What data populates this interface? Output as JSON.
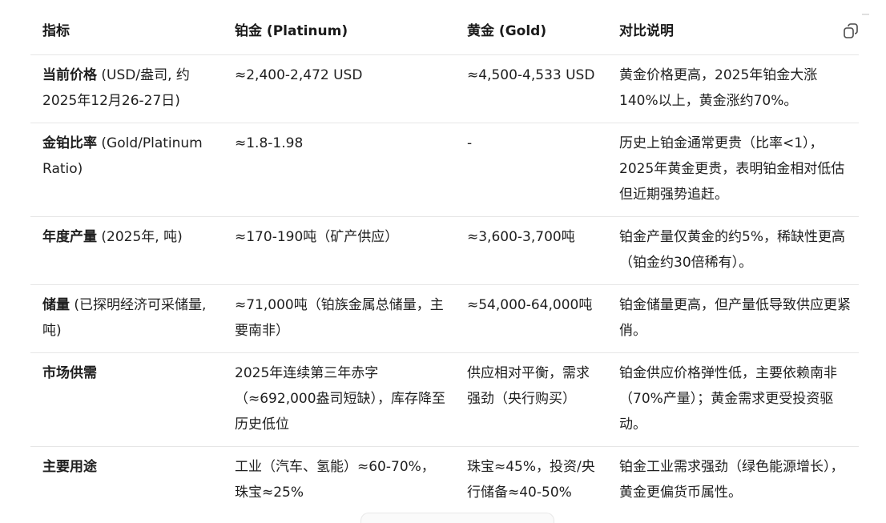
{
  "table": {
    "headers": [
      "指标",
      "铂金 (Platinum)",
      "黄金 (Gold)",
      "对比说明"
    ],
    "rows": [
      {
        "metric_bold": "当前价格",
        "metric_rest": " (USD/盎司, 约2025年12月26-27日)",
        "platinum": "≈2,400-2,472 USD",
        "gold": "≈4,500-4,533 USD",
        "note": "黄金价格更高，2025年铂金大涨140%以上，黄金涨约70%。"
      },
      {
        "metric_bold": "金铂比率",
        "metric_rest": " (Gold/Platinum Ratio)",
        "platinum": "≈1.8-1.98",
        "gold": "-",
        "note": "历史上铂金通常更贵（比率<1），2025年黄金更贵，表明铂金相对低估但近期强势追赶。"
      },
      {
        "metric_bold": "年度产量",
        "metric_rest": " (2025年, 吨)",
        "platinum": "≈170-190吨（矿产供应）",
        "gold": "≈3,600-3,700吨",
        "note": "铂金产量仅黄金的约5%，稀缺性更高（铂金约30倍稀有）。"
      },
      {
        "metric_bold": "储量",
        "metric_rest": " (已探明经济可采储量, 吨)",
        "platinum": "≈71,000吨（铂族金属总储量，主要南非）",
        "gold": "≈54,000-64,000吨",
        "note": "铂金储量更高，但产量低导致供应更紧俏。"
      },
      {
        "metric_bold": "市场供需",
        "metric_rest": "",
        "platinum": "2025年连续第三年赤字（≈692,000盎司短缺），库存降至历史低位",
        "gold": "供应相对平衡，需求强劲（央行购买）",
        "note": "铂金供应价格弹性低，主要依赖南非（70%产量）；黄金需求更受投资驱动。"
      },
      {
        "metric_bold": "主要用途",
        "metric_rest": "",
        "platinum": "工业（汽车、氢能）≈60-70%，珠宝≈25%",
        "gold": "珠宝≈45%，投资/央行储备≈40-50%",
        "note": "铂金工业需求强劲（绿色能源增长），黄金更偏货币属性。"
      }
    ]
  },
  "icons": {
    "copy": "copy-icon",
    "corner": "corner-mark-icon"
  }
}
